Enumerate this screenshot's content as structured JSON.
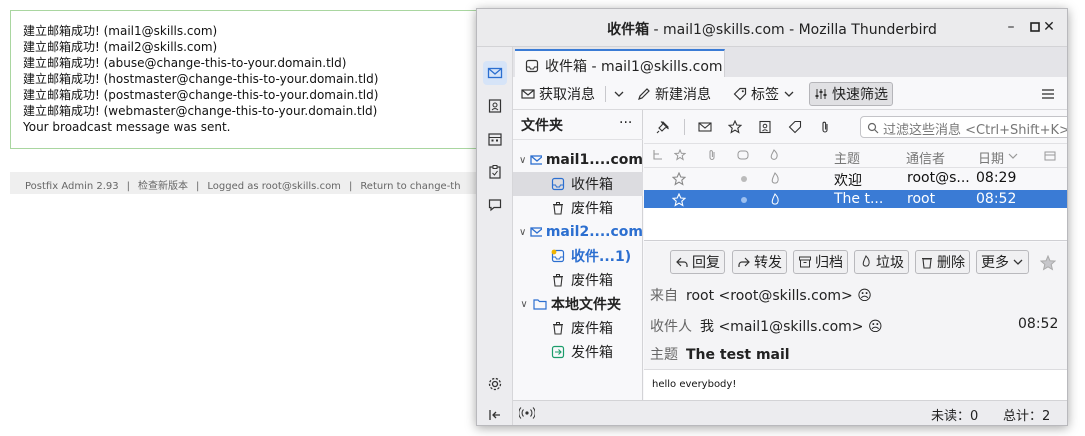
{
  "background_page": {
    "messages": [
      "建立邮箱成功! (mail1@skills.com)",
      "建立邮箱成功! (mail2@skills.com)",
      "建立邮箱成功! (abuse@change-this-to-your.domain.tld)",
      "建立邮箱成功! (hostmaster@change-this-to-your.domain.tld)",
      "建立邮箱成功! (postmaster@change-this-to-your.domain.tld)",
      "建立邮箱成功! (webmaster@change-this-to-your.domain.tld)",
      "Your broadcast message was sent."
    ],
    "footer": {
      "version": "Postfix Admin 2.93",
      "check_version": "检查新版本",
      "logged_as": "Logged as root@skills.com",
      "return_link": "Return to change-th"
    }
  },
  "window": {
    "title_bold": "收件箱",
    "title_rest": " - mail1@skills.com - Mozilla Thunderbird",
    "minimize": "–",
    "maximize": "□",
    "close": "✕"
  },
  "tab": {
    "label": "收件箱 - mail1@skills.com"
  },
  "toolbar": {
    "get_messages": "获取消息",
    "new_message": "新建消息",
    "tag": "标签",
    "quick_filter": "快速筛选"
  },
  "folders": {
    "header": "文件夹",
    "more": "···",
    "account1": "mail1....com",
    "inbox1": "收件箱",
    "trash1": "废件箱",
    "account2": "mail2....com",
    "inbox2": "收件...1)",
    "trash2": "废件箱",
    "local": "本地文件夹",
    "trash_local": "废件箱",
    "outbox": "发件箱"
  },
  "thread": {
    "filter_placeholder": "过滤这些消息 <Ctrl+Shift+K>",
    "columns": {
      "subject": "主题",
      "correspondent": "通信者",
      "date": "日期"
    },
    "messages": [
      {
        "subject": "欢迎",
        "from": "root@s...",
        "date": "08:29",
        "selected": false
      },
      {
        "subject": "The t...",
        "from": "root",
        "date": "08:52",
        "selected": true
      }
    ]
  },
  "message": {
    "buttons": {
      "reply": "回复",
      "forward": "转发",
      "archive": "归档",
      "junk": "垃圾",
      "delete": "删除",
      "more": "更多"
    },
    "from_label": "来自",
    "from_value": "root <root@skills.com>",
    "to_label": "收件人",
    "to_value": "我 <mail1@skills.com>",
    "time": "08:52",
    "subject_label": "主题",
    "subject_value": "The test mail",
    "body": "hello everybody!"
  },
  "status": {
    "unread": "未读：0",
    "total": "总计：2"
  },
  "colors": {
    "accent": "#3a7bd5",
    "bg_border": "#a9d6a0"
  }
}
